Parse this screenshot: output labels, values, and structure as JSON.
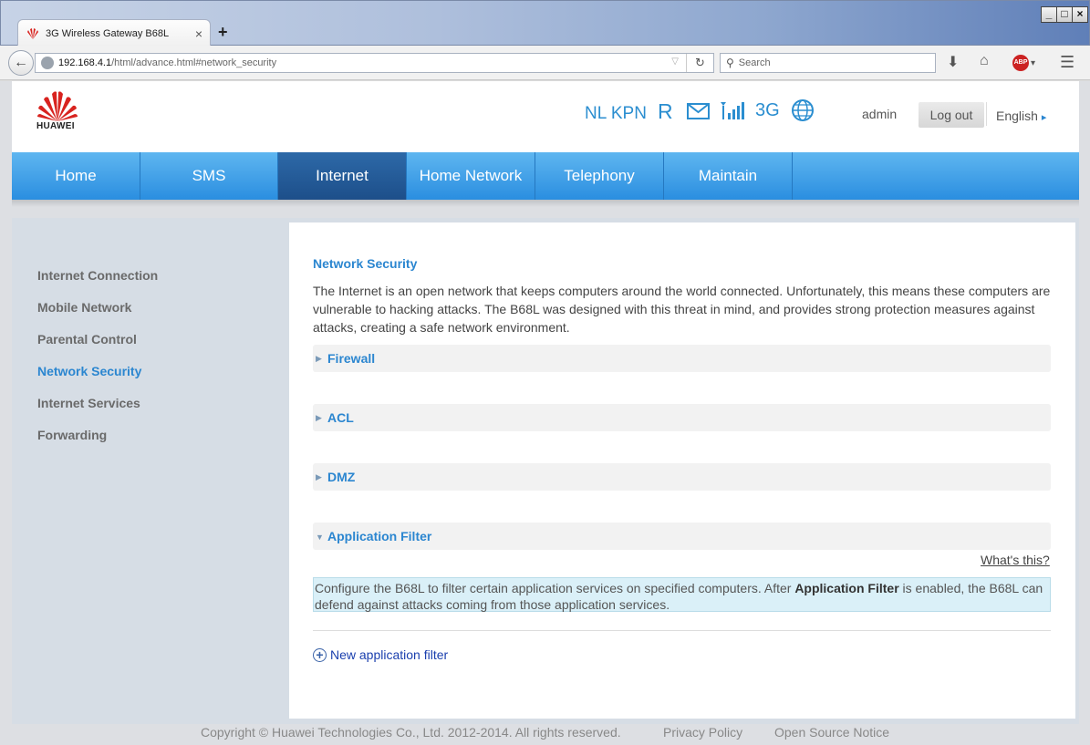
{
  "browser": {
    "tab_title": "3G Wireless Gateway B68L",
    "tab_close": "×",
    "new_tab": "+",
    "url_host": "192.168.4.1",
    "url_path": "/html/advance.html#network_security",
    "search_placeholder": "Search",
    "window_controls": [
      "_",
      "□",
      "×"
    ],
    "abp_label": "ABP"
  },
  "header": {
    "brand": "HUAWEI",
    "operator": "NL KPN",
    "roaming": "R",
    "network_type": "3G",
    "user": "admin",
    "logout_label": "Log out",
    "language": "English"
  },
  "main_nav": [
    {
      "label": "Home",
      "active": false
    },
    {
      "label": "SMS",
      "active": false
    },
    {
      "label": "Internet",
      "active": true
    },
    {
      "label": "Home Network",
      "active": false
    },
    {
      "label": "Telephony",
      "active": false
    },
    {
      "label": "Maintain",
      "active": false
    }
  ],
  "sidebar": [
    {
      "label": "Internet Connection",
      "active": false
    },
    {
      "label": "Mobile Network",
      "active": false
    },
    {
      "label": "Parental Control",
      "active": false
    },
    {
      "label": "Network Security",
      "active": true
    },
    {
      "label": "Internet Services",
      "active": false
    },
    {
      "label": "Forwarding",
      "active": false
    }
  ],
  "content": {
    "title": "Network Security",
    "intro": "The Internet is an open network that keeps computers around the world connected. Unfortunately, this means these computers are vulnerable to hacking attacks. The B68L was designed with this threat in mind, and provides strong protection measures against attacks, creating a safe network environment.",
    "sections": [
      {
        "label": "Firewall",
        "expanded": false
      },
      {
        "label": "ACL",
        "expanded": false
      },
      {
        "label": "DMZ",
        "expanded": false
      },
      {
        "label": "Application Filter",
        "expanded": true
      }
    ],
    "whats_this": "What's this?",
    "info_pre": "Configure the B68L to filter certain application services on specified computers. After ",
    "info_bold": "Application Filter",
    "info_post": " is enabled, the B68L can defend against attacks coming from those application services.",
    "new_filter_label": "New application filter"
  },
  "footer": {
    "copyright": "Copyright © Huawei Technologies Co., Ltd. 2012-2014. All rights reserved.",
    "privacy": "Privacy Policy",
    "open_source": "Open Source Notice"
  },
  "colors": {
    "accent": "#2b86d0",
    "nav_active": "#1d4f8a",
    "info_bg": "#daf0f8"
  }
}
